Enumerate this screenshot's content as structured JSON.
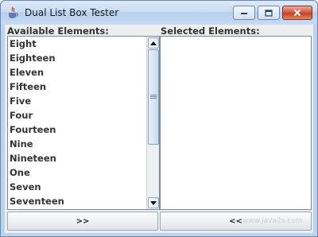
{
  "window": {
    "title": "Dual List Box Tester",
    "icon": "java-icon"
  },
  "left_panel": {
    "label": "Available Elements:",
    "items": [
      "Eight",
      "Eighteen",
      "Eleven",
      "Fifteen",
      "Five",
      "Four",
      "Fourteen",
      "Nine",
      "Nineteen",
      "One",
      "Seven",
      "Seventeen"
    ]
  },
  "right_panel": {
    "label": "Selected Elements:",
    "items": []
  },
  "buttons": {
    "add_label": ">>",
    "remove_label": "<<"
  },
  "watermark": "www.java2s.com"
}
